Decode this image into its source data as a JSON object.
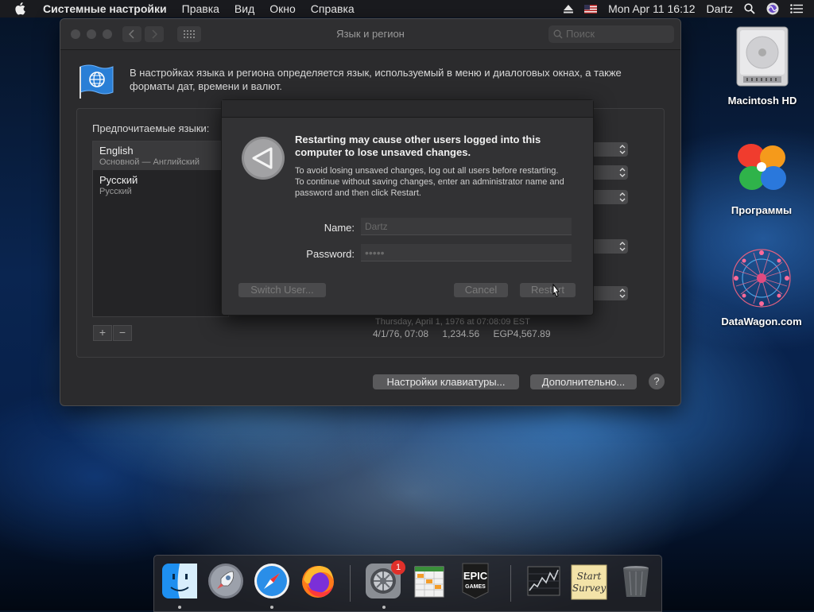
{
  "menubar": {
    "app_name": "Системные настройки",
    "items": [
      "Правка",
      "Вид",
      "Окно",
      "Справка"
    ],
    "clock": "Mon Apr 11  16:12",
    "user": "Dartz"
  },
  "window": {
    "title": "Язык и регион",
    "search_placeholder": "Поиск",
    "description": "В настройках языка и региона определяется язык, используемый в меню и диалоговых окнах, а также форматы дат, времени и валют.",
    "preferred_label": "Предпочитаемые языки:",
    "languages": [
      {
        "name": "English",
        "sub": "Основной — Английский"
      },
      {
        "name": "Русский",
        "sub": "Русский"
      }
    ],
    "add_label": "+",
    "remove_label": "−",
    "format_date": "Thursday, April 1, 1976 at 07:08:09 EST",
    "format_short": "4/1/76, 07:08",
    "format_number": "1,234.56",
    "format_currency": "EGP4,567.89",
    "keyboard_button": "Настройки клавиатуры...",
    "advanced_button": "Дополнительно...",
    "help_label": "?"
  },
  "dialog": {
    "heading": "Restarting may cause other users logged into this computer to lose unsaved changes.",
    "info": "To avoid losing unsaved changes, log out all users before restarting. To continue without saving changes, enter an administrator name and password and then click Restart.",
    "name_label": "Name:",
    "name_value": "Dartz",
    "password_label": "Password:",
    "password_value": "•••••",
    "switch_user": "Switch User...",
    "cancel": "Cancel",
    "restart": "Restart"
  },
  "desktop": {
    "icons": [
      {
        "label": "Macintosh HD"
      },
      {
        "label": "Программы"
      },
      {
        "label": "DataWagon.com"
      }
    ]
  },
  "dock": {
    "apps": [
      "Finder",
      "Launchpad",
      "Safari",
      "Firefox",
      "System Preferences",
      "Numbers",
      "Epic Games",
      "Stocks",
      "Start Survey",
      "Trash"
    ],
    "system_prefs_badge": "1",
    "epic_text_1": "EPIC",
    "epic_text_2": "GAMES",
    "survey_text_1": "Start",
    "survey_text_2": "Survey"
  }
}
